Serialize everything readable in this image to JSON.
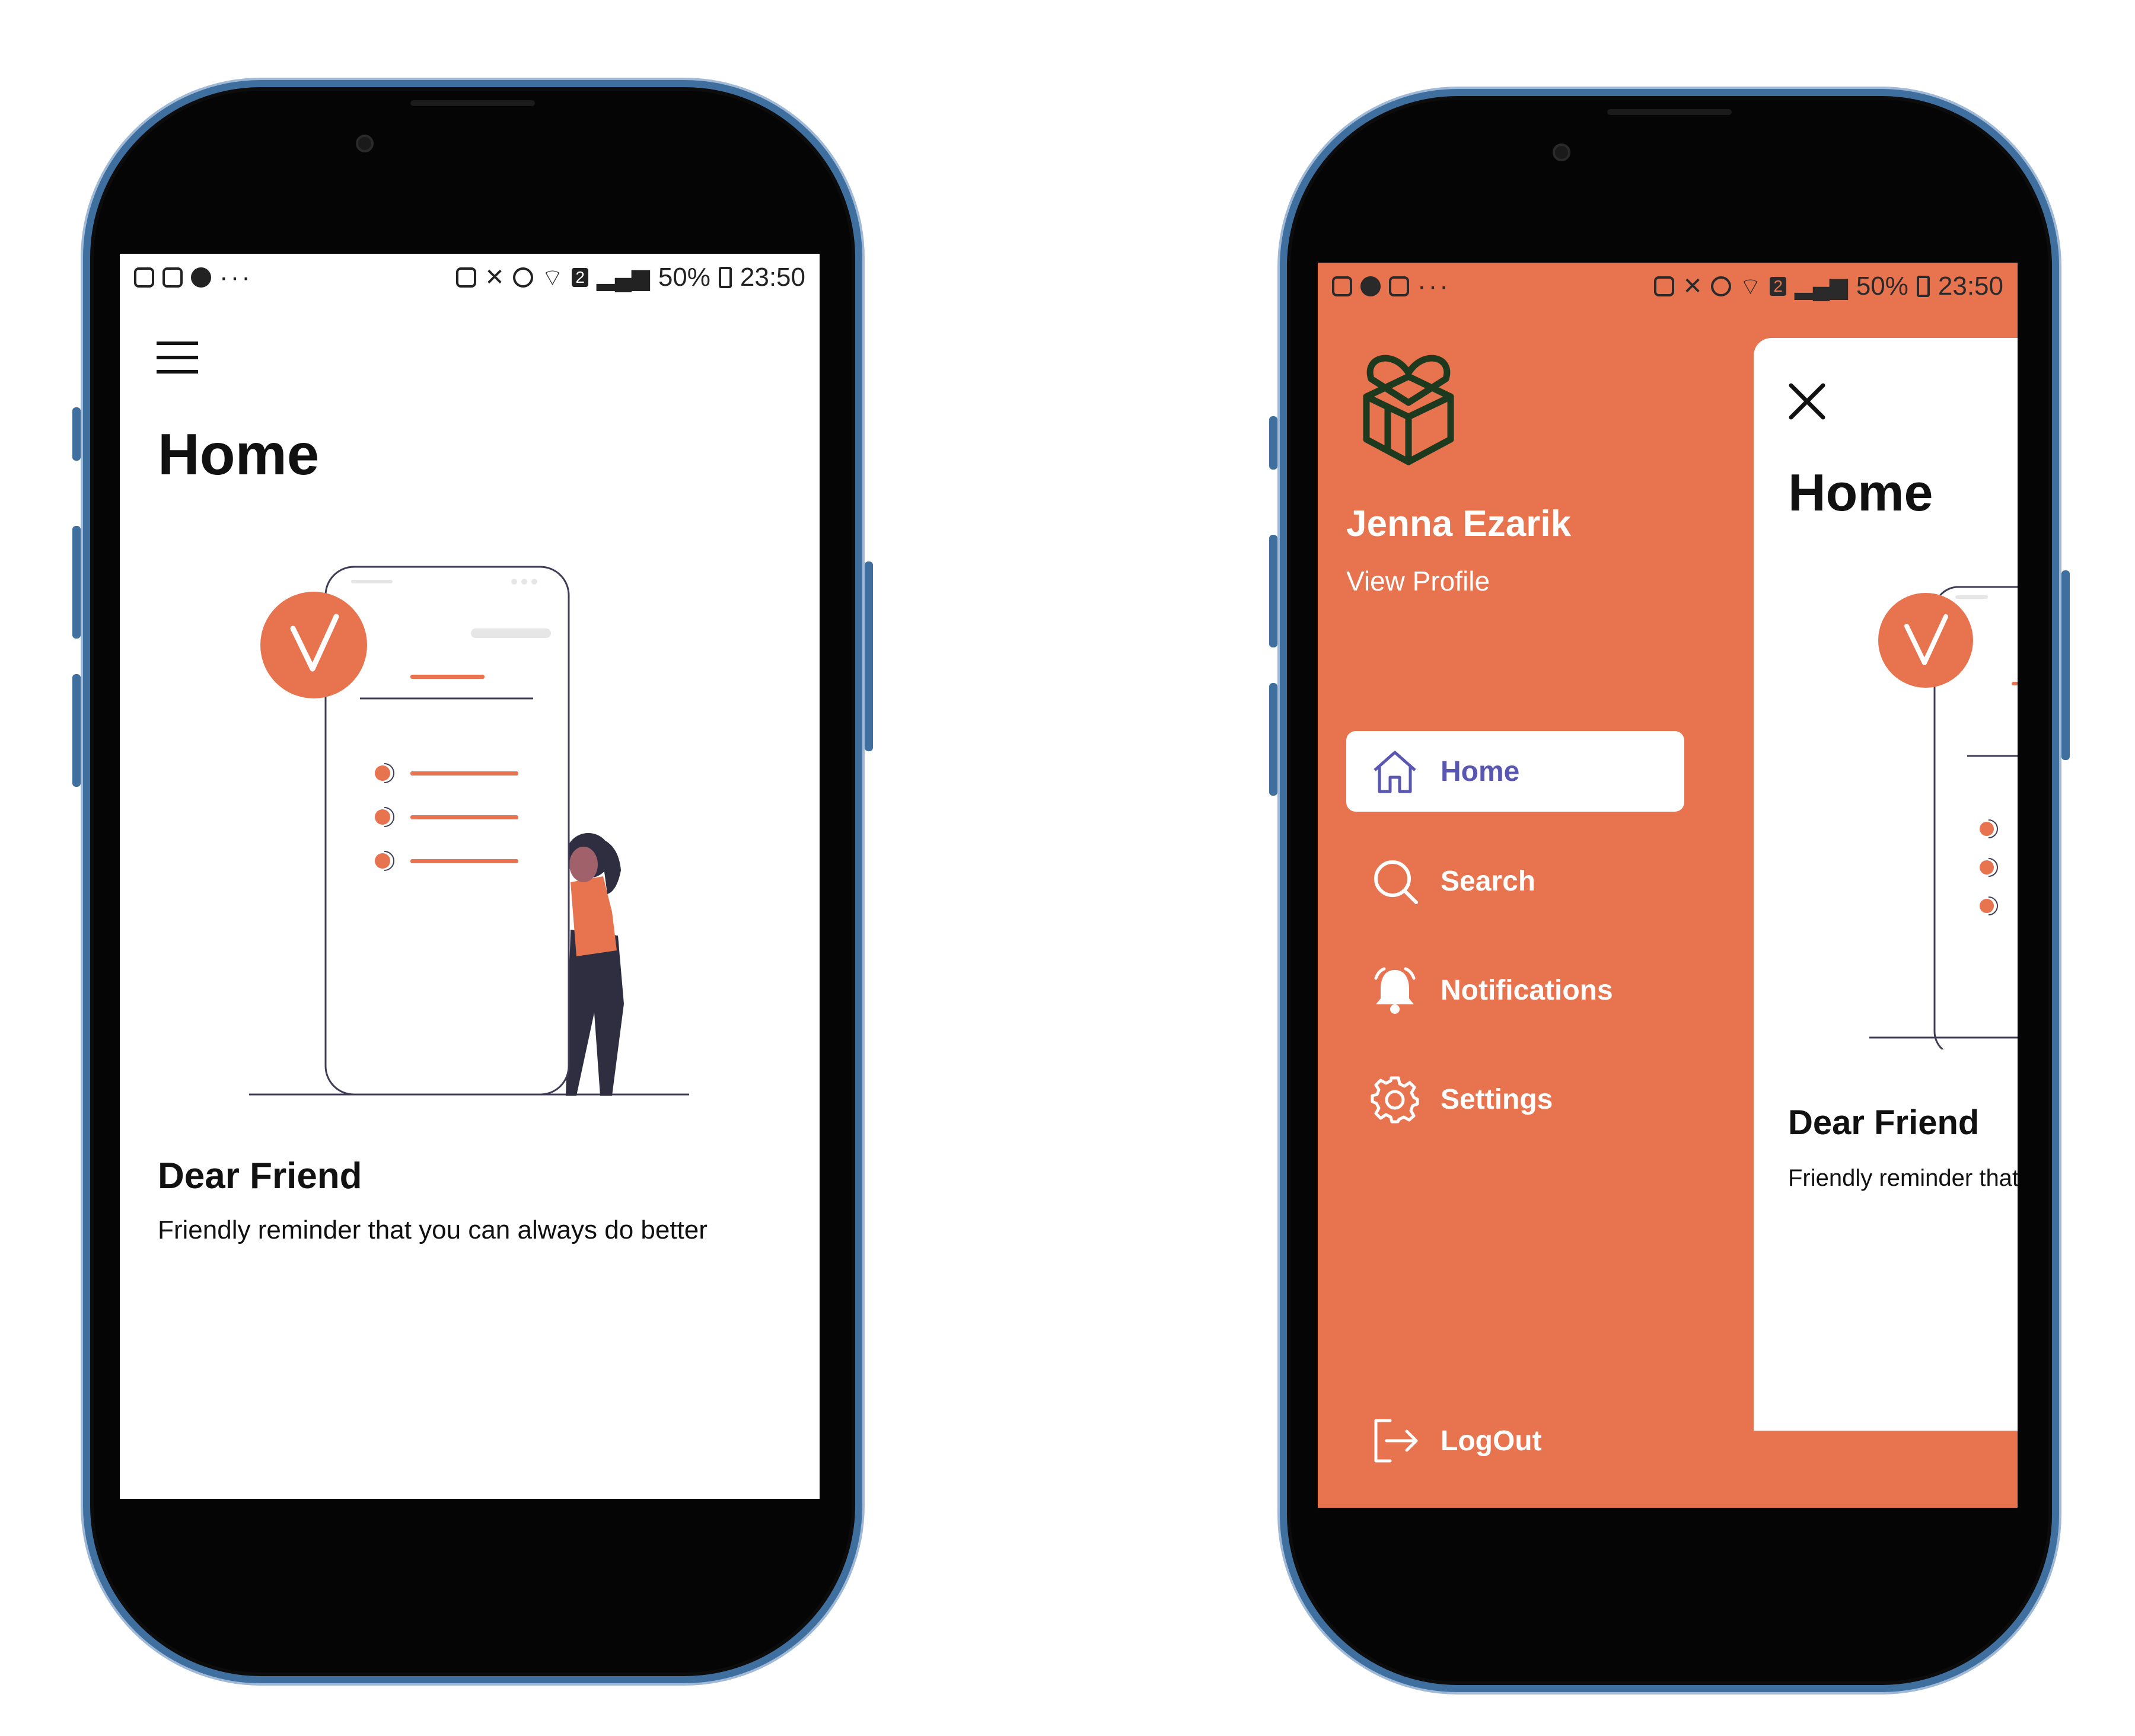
{
  "colors": {
    "accent": "#E8734F",
    "nav_active_text": "#5957B2",
    "frame": "#3f6f9f"
  },
  "status_bar": {
    "battery": "50%",
    "time": "23:50",
    "sim_badge": "2"
  },
  "left_phone": {
    "page_title": "Home",
    "card_title": "Dear Friend",
    "card_text": "Friendly reminder that you can always do better",
    "menu_icon": "hamburger-icon"
  },
  "right_phone": {
    "profile": {
      "name": "Jenna Ezarik",
      "link": "View Profile",
      "logo_icon": "heart-box-logo-icon"
    },
    "nav": [
      {
        "label": "Home",
        "icon": "home-icon",
        "active": true
      },
      {
        "label": "Search",
        "icon": "search-icon",
        "active": false
      },
      {
        "label": "Notifications",
        "icon": "bell-icon",
        "active": false
      },
      {
        "label": "Settings",
        "icon": "gear-icon",
        "active": false
      }
    ],
    "logout": {
      "label": "LogOut",
      "icon": "logout-icon"
    },
    "preview": {
      "close_icon": "close-icon",
      "page_title": "Home",
      "card_title": "Dear Friend",
      "card_text": "Friendly reminder that"
    }
  }
}
